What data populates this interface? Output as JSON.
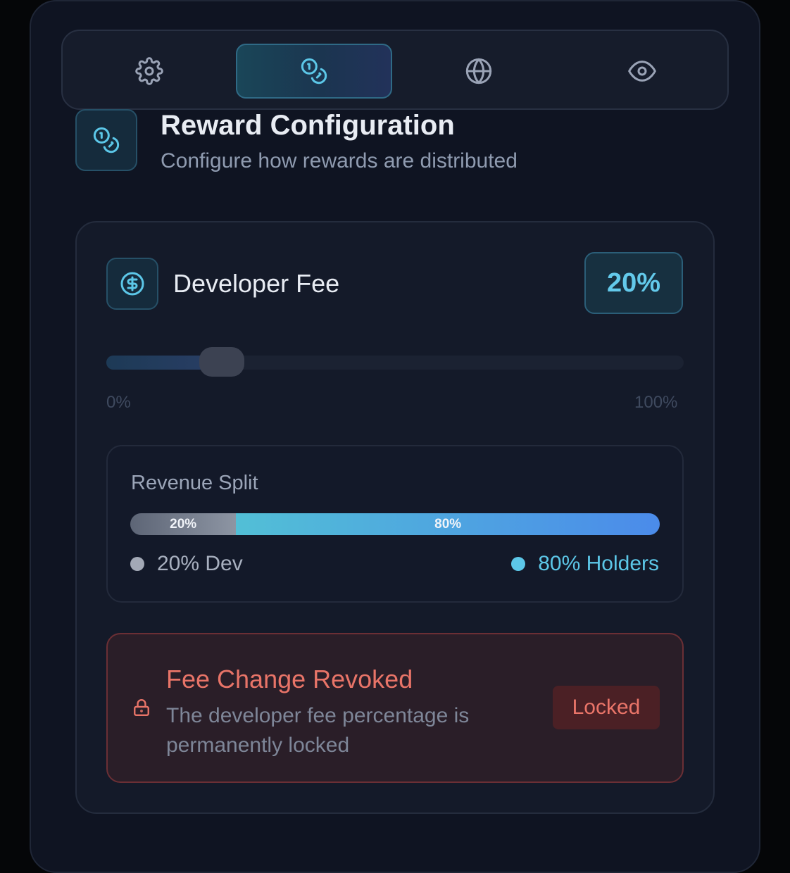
{
  "tabs": [
    {
      "icon": "gear-icon",
      "active": false
    },
    {
      "icon": "coins-icon",
      "active": true
    },
    {
      "icon": "globe-icon",
      "active": false
    },
    {
      "icon": "eye-icon",
      "active": false
    }
  ],
  "header": {
    "icon": "coins-icon",
    "title": "Reward Configuration",
    "subtitle": "Configure how rewards are distributed"
  },
  "developer_fee": {
    "icon": "dollar-circle-icon",
    "label": "Developer Fee",
    "value_text": "20%",
    "value_percent": 20,
    "range_min_label": "0%",
    "range_max_label": "100%"
  },
  "revenue_split": {
    "title": "Revenue Split",
    "dev_bar_label": "20%",
    "holders_bar_label": "80%",
    "dev_percent": 20,
    "holders_percent": 80,
    "dev_legend": "20% Dev",
    "holders_legend": "80% Holders",
    "dev_color": "#a3a9b6",
    "holders_color": "#5cc7e8"
  },
  "alert": {
    "icon": "lock-icon",
    "title": "Fee Change Revoked",
    "description": "The developer fee percentage is permanently locked",
    "badge": "Locked",
    "color": "#e87468"
  }
}
